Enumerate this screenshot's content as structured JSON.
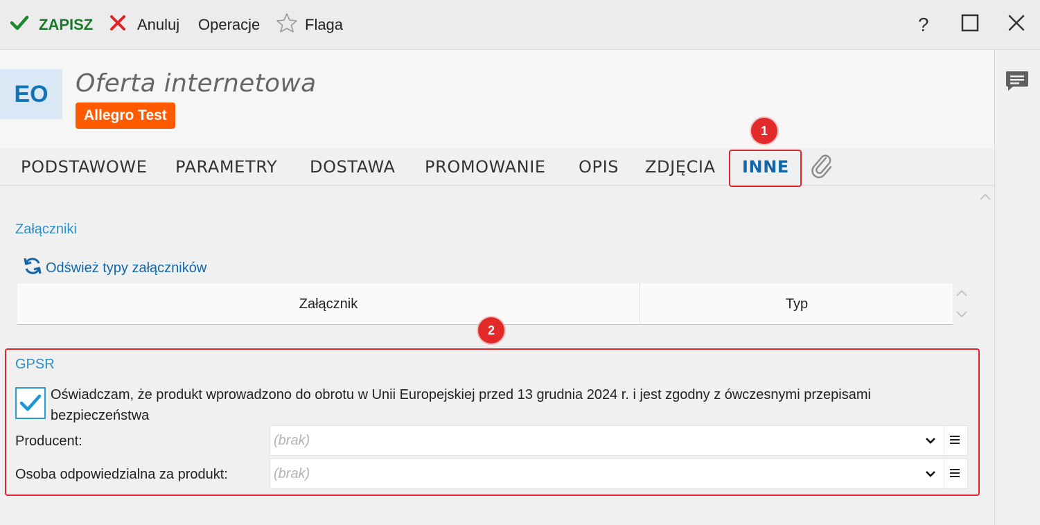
{
  "toolbar": {
    "save_label": "ZAPISZ",
    "cancel_label": "Anuluj",
    "operations_label": "Operacje",
    "flag_label": "Flaga",
    "help_label": "?"
  },
  "header": {
    "avatar_initials": "EO",
    "title": "Oferta internetowa",
    "badge": "Allegro Test"
  },
  "tabs": [
    {
      "label": "PODSTAWOWE",
      "active": false
    },
    {
      "label": "PARAMETRY",
      "active": false
    },
    {
      "label": "DOSTAWA",
      "active": false
    },
    {
      "label": "PROMOWANIE",
      "active": false
    },
    {
      "label": "OPIS",
      "active": false
    },
    {
      "label": "ZDJĘCIA",
      "active": false
    },
    {
      "label": "INNE",
      "active": true
    }
  ],
  "annotations": [
    "1",
    "2"
  ],
  "attachments": {
    "section_title": "Załączniki",
    "refresh_link": "Odśwież typy załączników",
    "columns": [
      "Załącznik",
      "Typ"
    ]
  },
  "gpsr": {
    "section_title": "GPSR",
    "declaration_checked": true,
    "declaration_text": "Oświadczam, że produkt wprowadzono do obrotu w Unii Europejskiej przed 13 grudnia 2024 r. i jest zgodny z ówczesnymi przepisami bezpieczeństwa",
    "fields": [
      {
        "label": "Producent:",
        "value": "(brak)"
      },
      {
        "label": "Osoba odpowiedzialna za produkt:",
        "value": "(brak)"
      }
    ]
  },
  "colors": {
    "accent": "#1167a8",
    "section_title": "#2b8fc7",
    "badge": "#ff5a00",
    "annotation": "#e0242b",
    "save": "#1a7a2a"
  }
}
